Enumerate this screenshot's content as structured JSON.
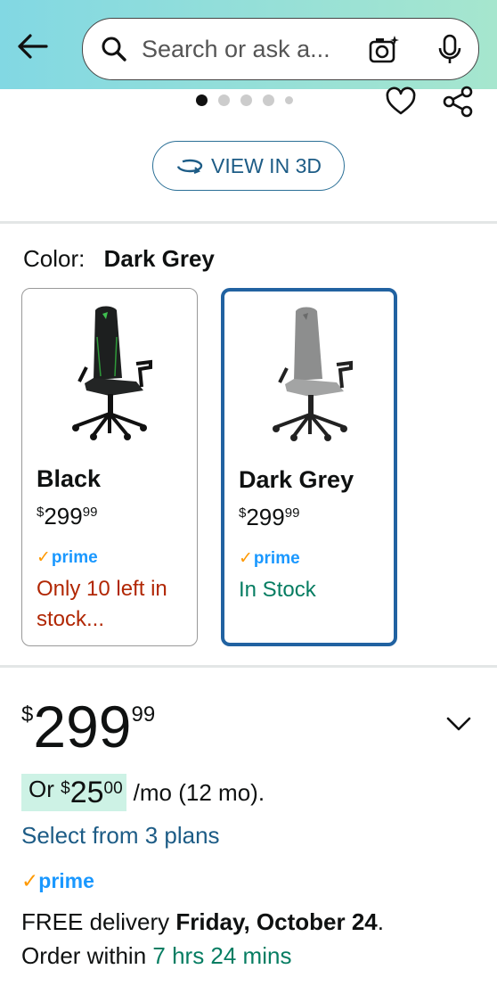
{
  "search": {
    "placeholder": "Search or ask a..."
  },
  "carousel": {
    "dots": 5,
    "active": 0
  },
  "view3d": {
    "label": "VIEW IN 3D"
  },
  "color": {
    "label": "Color:",
    "selected": "Dark Grey"
  },
  "swatches": [
    {
      "name": "Black",
      "price_symbol": "$",
      "price_whole": "299",
      "price_fraction": "99",
      "prime": "prime",
      "stock": "Only 10 left in stock..."
    },
    {
      "name": "Dark Grey",
      "price_symbol": "$",
      "price_whole": "299",
      "price_fraction": "99",
      "prime": "prime",
      "stock": "In Stock"
    }
  ],
  "price": {
    "symbol": "$",
    "whole": "299",
    "fraction": "99"
  },
  "monthly": {
    "prefix": "Or",
    "symbol": "$",
    "whole": "25",
    "fraction": "00",
    "suffix": "/mo (12 mo)."
  },
  "plans_link": "Select from 3 plans",
  "prime_label": "prime",
  "delivery": {
    "line1_prefix": "FREE delivery",
    "date": "Friday, October 24",
    "line1_suffix": ".",
    "line2_prefix": "Order within",
    "countdown": "7 hrs 24 mins"
  },
  "colors": {
    "accent": "#1d5c86",
    "prime_blue": "#1a98ff",
    "prime_check": "#ff9900",
    "stock_red": "#b12704",
    "stock_green": "#067d62",
    "selected_border": "#2162a1"
  }
}
